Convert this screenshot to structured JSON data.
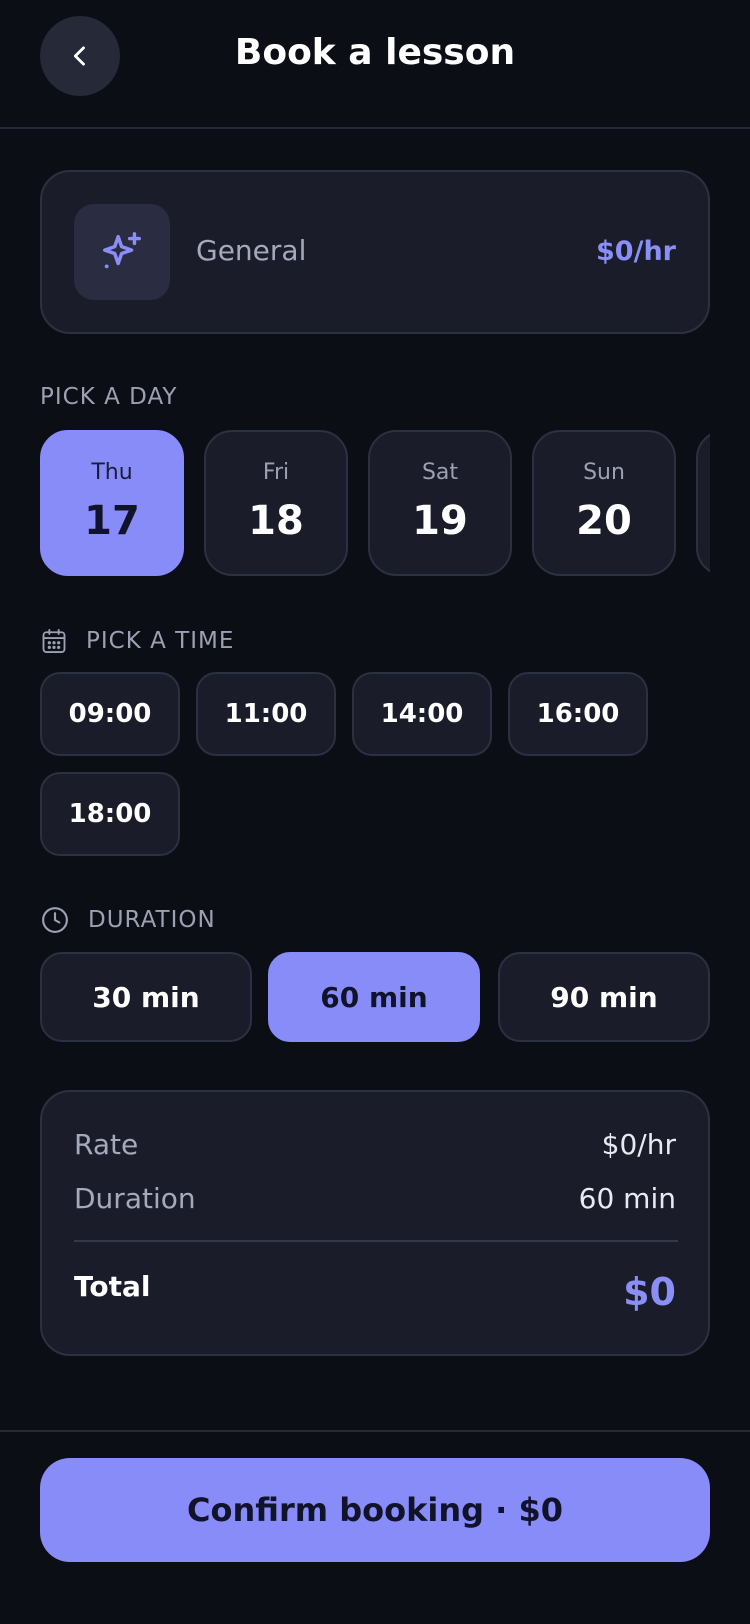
{
  "header": {
    "title": "Book a lesson",
    "back_icon": "chevron-left-icon"
  },
  "subject": {
    "name": "General",
    "rate": "$0/hr",
    "icon": "sparkle-icon"
  },
  "day_section": {
    "label": "PICK A DAY"
  },
  "days": [
    {
      "weekday": "Thu",
      "date": "17",
      "selected": true
    },
    {
      "weekday": "Fri",
      "date": "18",
      "selected": false
    },
    {
      "weekday": "Sat",
      "date": "19",
      "selected": false
    },
    {
      "weekday": "Sun",
      "date": "20",
      "selected": false
    }
  ],
  "time_section": {
    "label": "PICK A TIME",
    "icon": "calendar-icon"
  },
  "times": [
    "09:00",
    "11:00",
    "14:00",
    "16:00",
    "18:00"
  ],
  "duration_section": {
    "label": "DURATION",
    "icon": "clock-icon"
  },
  "durations": [
    {
      "label": "30 min",
      "selected": false
    },
    {
      "label": "60 min",
      "selected": true
    },
    {
      "label": "90 min",
      "selected": false
    }
  ],
  "summary": {
    "rate_label": "Rate",
    "rate_value": "$0/hr",
    "duration_label": "Duration",
    "duration_value": "60 min",
    "total_label": "Total",
    "total_value": "$0"
  },
  "footer": {
    "confirm_label": "Confirm booking · $0"
  },
  "colors": {
    "accent": "#878cf8",
    "background": "#0c0e16",
    "card": "#1a1d29"
  }
}
